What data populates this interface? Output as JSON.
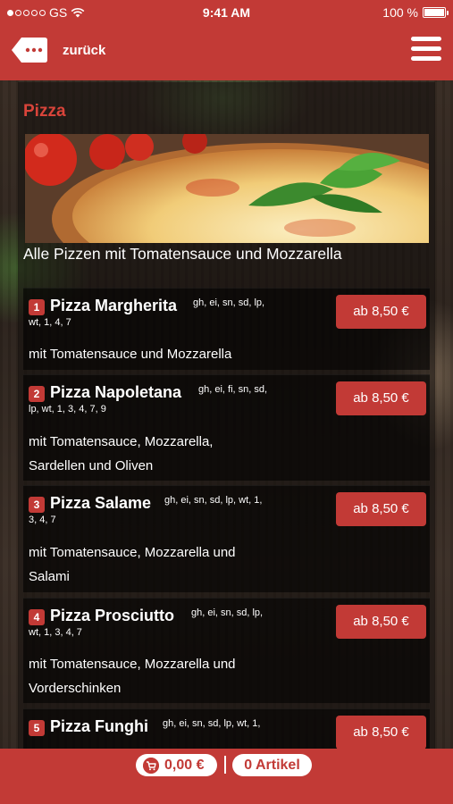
{
  "status_bar": {
    "carrier": "GS",
    "time": "9:41 AM",
    "battery": "100 %"
  },
  "header": {
    "back_label": "zurück",
    "back_icon": "back-chat-icon",
    "menu_icon": "hamburger-menu-icon"
  },
  "section": {
    "title": "Pizza",
    "description": "Alle Pizzen mit Tomatensauce und Mozzarella"
  },
  "items": [
    {
      "number": "1",
      "name": "Pizza Margherita",
      "allergens_1": "gh, ei, sn, sd, lp,",
      "allergens_2": "wt, 1, 4, 7",
      "desc_1": "mit Tomatensauce und Mozzarella",
      "desc_2": "",
      "price": "ab 8,50 €"
    },
    {
      "number": "2",
      "name": "Pizza Napoletana",
      "allergens_1": "gh, ei, fi, sn, sd,",
      "allergens_2": "lp, wt, 1, 3, 4, 7, 9",
      "desc_1": "mit Tomatensauce, Mozzarella,",
      "desc_2": "Sardellen und Oliven",
      "price": "ab 8,50 €"
    },
    {
      "number": "3",
      "name": "Pizza Salame",
      "allergens_1": "gh, ei, sn, sd, lp, wt, 1,",
      "allergens_2": "3, 4, 7",
      "desc_1": "mit Tomatensauce, Mozzarella und",
      "desc_2": "Salami",
      "price": "ab 8,50 €"
    },
    {
      "number": "4",
      "name": "Pizza Prosciutto",
      "allergens_1": "gh, ei, sn, sd, lp,",
      "allergens_2": "wt, 1, 3, 4, 7",
      "desc_1": "mit Tomatensauce, Mozzarella und",
      "desc_2": "Vorderschinken",
      "price": "ab 8,50 €"
    },
    {
      "number": "5",
      "name": "Pizza Funghi",
      "allergens_1": "gh, ei, sn, sd, lp, wt, 1,",
      "allergens_2": "",
      "desc_1": "",
      "desc_2": "",
      "price": "ab 8,50 €"
    }
  ],
  "footer": {
    "cart_total": "0,00 €",
    "cart_icon": "shopping-cart-icon",
    "article_count": "0 Artikel"
  },
  "colors": {
    "brand_red": "#c23a36",
    "title_red": "#d9443a"
  }
}
